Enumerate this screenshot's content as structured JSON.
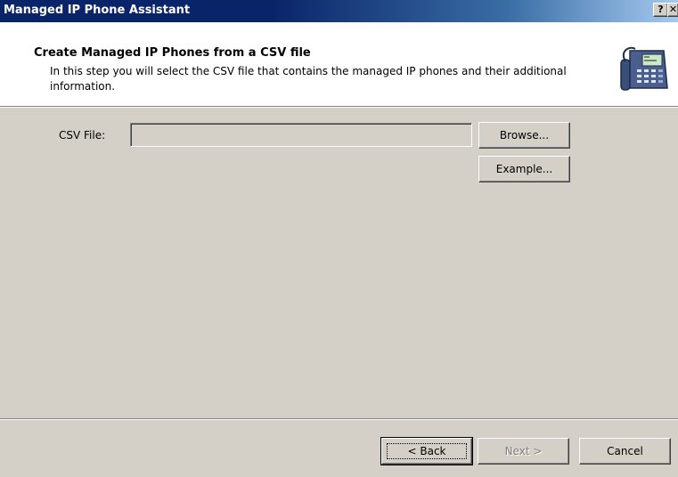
{
  "window": {
    "title": "Managed IP Phone Assistant",
    "help_button": "?",
    "close_button": "✕"
  },
  "header": {
    "title": "Create Managed IP Phones from a CSV file",
    "description": "In this step you will select the CSV file that contains the managed IP phones and their additional information.",
    "icon": "ip-phone-icon"
  },
  "form": {
    "csv_label": "CSV File:",
    "csv_value": "",
    "browse_label": "Browse...",
    "example_label": "Example..."
  },
  "footer": {
    "back_label": "< Back",
    "next_label": "Next >",
    "cancel_label": "Cancel",
    "next_enabled": false
  },
  "colors": {
    "title_bar": "#0a246a",
    "dialog_face": "#d4d0c8",
    "header_bg": "#ffffff"
  }
}
